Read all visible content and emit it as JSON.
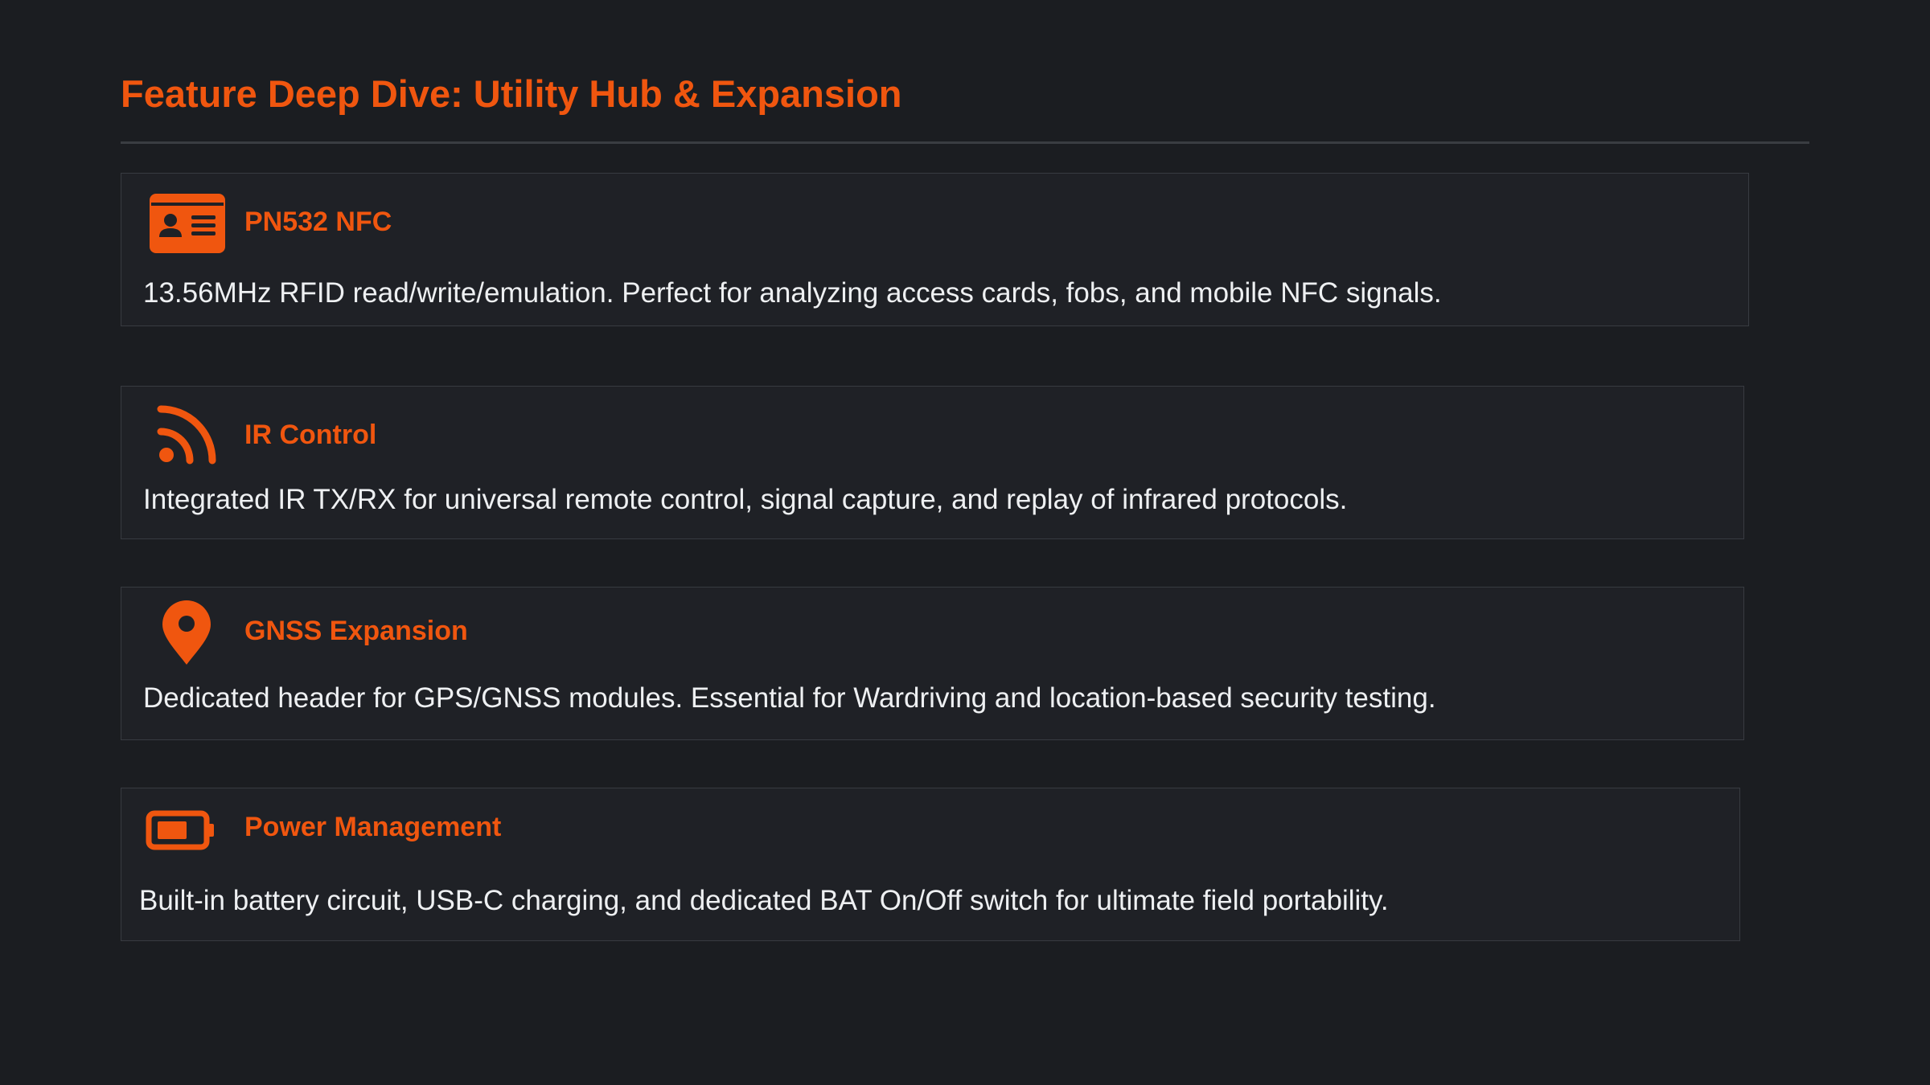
{
  "page": {
    "title": "Feature Deep Dive: Utility Hub & Expansion",
    "accent_color": "#f0560f",
    "background_color": "#1b1d21"
  },
  "features": [
    {
      "icon": "id-card-icon",
      "title": "PN532 NFC",
      "description": "13.56MHz RFID read/write/emulation. Perfect for analyzing access cards, fobs, and mobile NFC signals."
    },
    {
      "icon": "rss-signal-icon",
      "title": "IR Control",
      "description": "Integrated IR TX/RX for universal remote control, signal capture, and replay of infrared protocols."
    },
    {
      "icon": "map-pin-icon",
      "title": "GNSS Expansion",
      "description": "Dedicated header for GPS/GNSS modules. Essential for Wardriving and location-based security testing."
    },
    {
      "icon": "battery-icon",
      "title": "Power Management",
      "description": "Built-in battery circuit, USB-C charging, and dedicated BAT On/Off switch for ultimate field portability."
    }
  ]
}
